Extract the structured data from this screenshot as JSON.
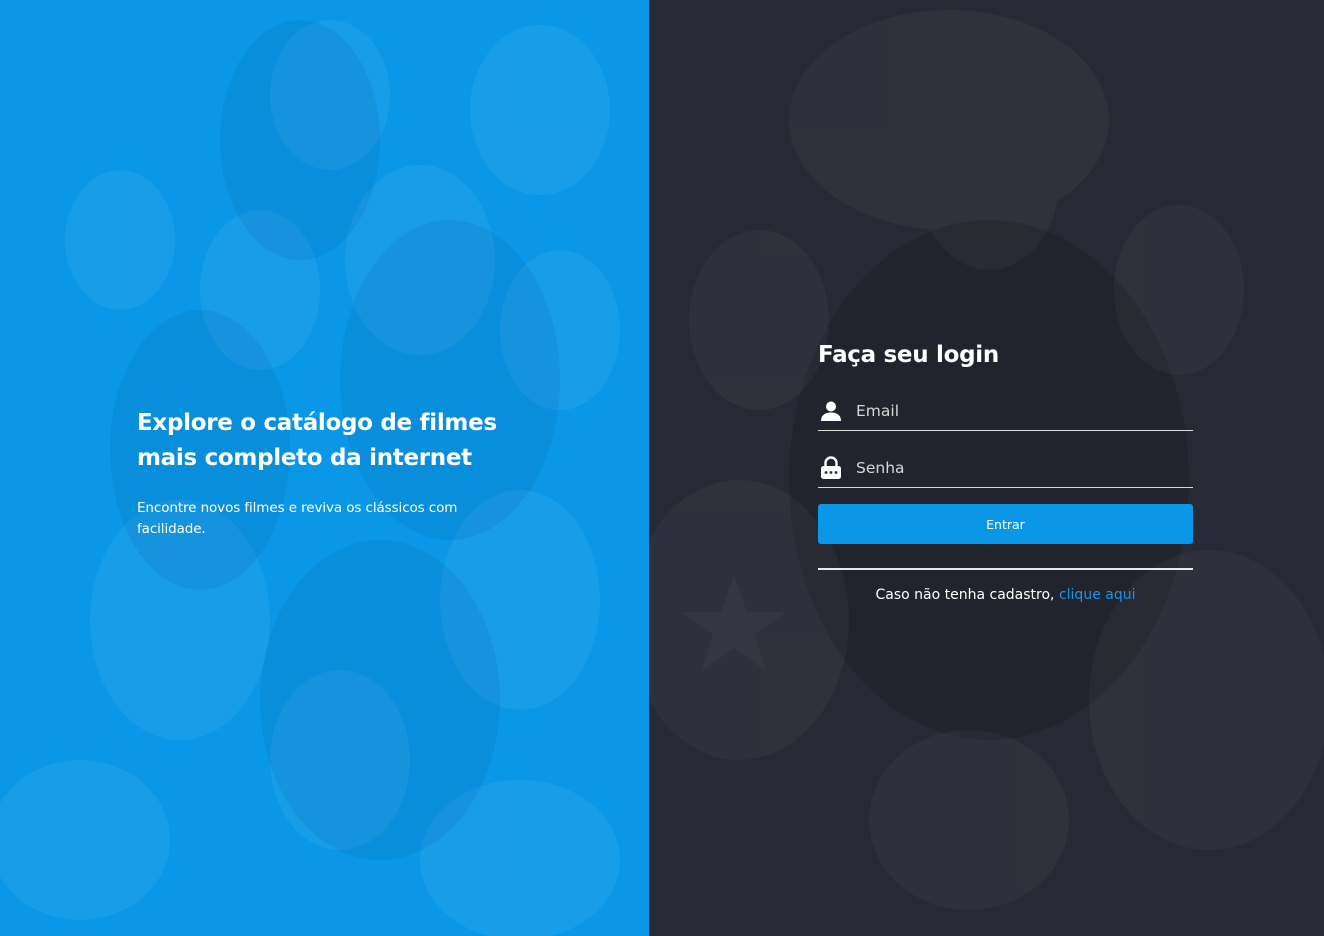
{
  "hero": {
    "title_line1": "Explore o catálogo de filmes",
    "title_line2": "mais completo da internet",
    "subtitle": "Encontre novos filmes e reviva os clássicos com facilidade."
  },
  "login": {
    "title": "Faça seu login",
    "email_placeholder": "Email",
    "password_placeholder": "Senha",
    "submit_label": "Entrar",
    "signup_text": "Caso não tenha cadastro,",
    "signup_link": "clique aqui"
  },
  "icons": {
    "email": "user-icon",
    "password": "lock-icon"
  },
  "colors": {
    "accent": "#0a97e8",
    "dark_panel": "#272a34",
    "link": "#1a95e6"
  }
}
